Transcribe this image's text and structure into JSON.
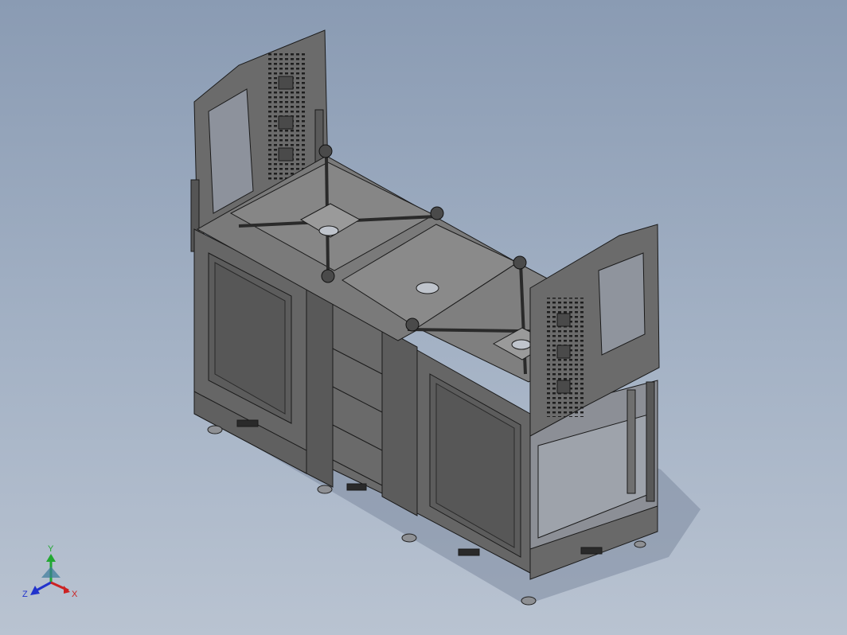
{
  "viewport": {
    "background_top": "#8a9bb3",
    "background_bottom": "#b9c3d1"
  },
  "model": {
    "shade_color": "#6a6a6a",
    "edge_color": "#1a1a1a"
  },
  "triad": {
    "y_label": "Y",
    "z_label": "Z",
    "x_label": "X",
    "y_color": "#22a832",
    "z_color": "#2233cc",
    "x_color": "#cc2222"
  }
}
